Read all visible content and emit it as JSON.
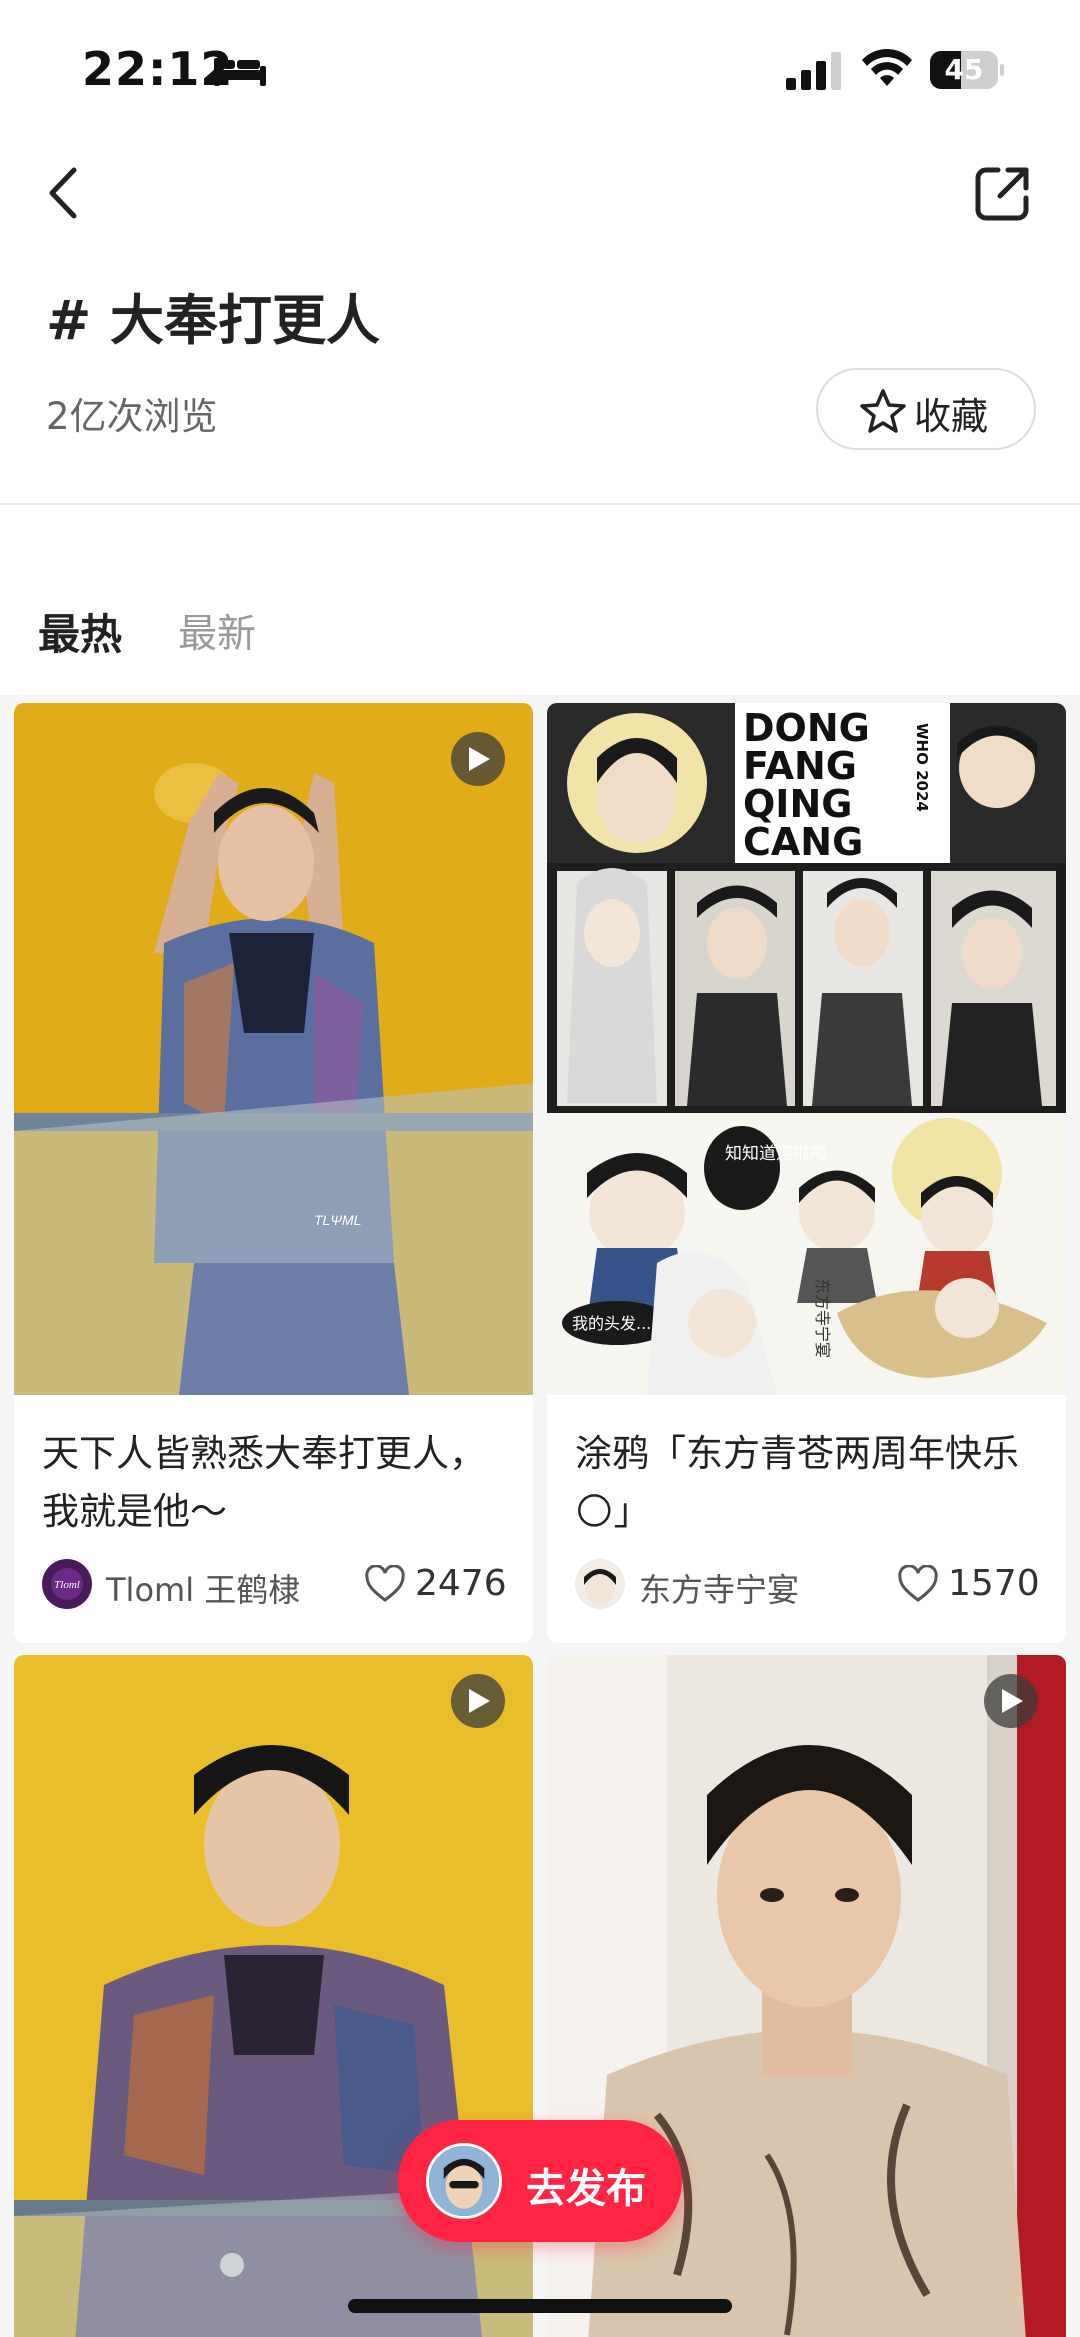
{
  "status_bar": {
    "time": "22:12",
    "battery": "45",
    "battery_level": 0.45
  },
  "header": {
    "title": "# 大奉打更人",
    "views": "2亿次浏览",
    "favorite_label": "收藏"
  },
  "tabs": [
    {
      "label": "最热",
      "active": true
    },
    {
      "label": "最新",
      "active": false
    }
  ],
  "cards": [
    {
      "title": "天下人皆熟悉大奉打更人，我就是他～",
      "author": "Tloml 王鹤棣",
      "likes": "2476",
      "is_video": true
    },
    {
      "title": "涂鸦「东方青苍两周年快乐🌕」",
      "author": "东方寺宁宴",
      "likes": "1570",
      "is_video": false
    },
    {
      "title": "",
      "author": "",
      "likes": "",
      "is_video": true
    },
    {
      "title": "",
      "author": "",
      "likes": "",
      "is_video": true
    }
  ],
  "card2_image_text": {
    "banner": [
      "DONG",
      "FANG",
      "QING",
      "CANG"
    ],
    "side": "WHO 2024",
    "bubble1": "知知道道啦啦",
    "bubble2": "我的头发...",
    "stamp": "东方寺宁宴"
  },
  "card1_watermark": "TLΨML",
  "publish": {
    "label": "去发布"
  },
  "colors": {
    "accent": "#ff2442",
    "background": "#f5f5f5"
  }
}
